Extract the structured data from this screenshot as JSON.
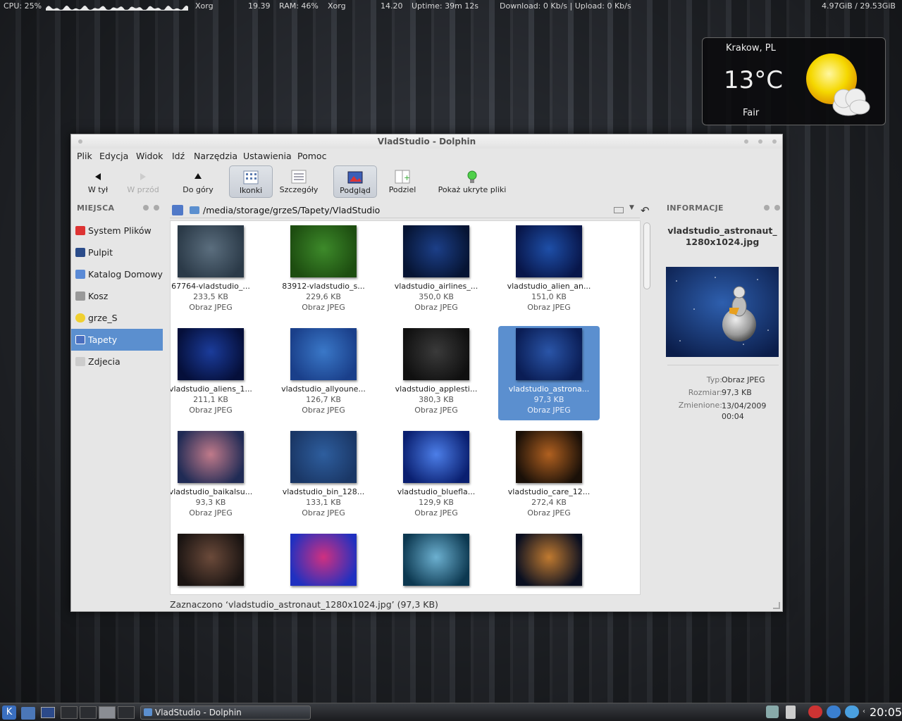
{
  "topbar": {
    "cpu_label": "CPU: 25%",
    "proc1": "Xorg",
    "val1": "19.39",
    "ram_label": "RAM: 46%",
    "proc2": "Xorg",
    "val2": "14.20",
    "uptime": "Uptime: 39m 12s",
    "network": "Download: 0 Kb/s | Upload: 0 Kb/s",
    "disk": "4.97GiB / 29.53GiB",
    "cpu_usage": 0.25
  },
  "weather": {
    "city": "Krakow, PL",
    "temp": "13°C",
    "condition": "Fair",
    "icon": "sun-cloud-icon"
  },
  "window": {
    "title": "VladStudio - Dolphin",
    "menu": [
      "Plik",
      "Edycja",
      "Widok",
      "Idź",
      "Narzędzia",
      "Ustawienia",
      "Pomoc"
    ],
    "toolbar": {
      "back": "W tył",
      "forward": "W przód",
      "up": "Do góry",
      "icons": "Ikonki",
      "details": "Szczegóły",
      "preview": "Podgląd",
      "split": "Podziel",
      "hidden": "Pokaż ukryte pliki"
    },
    "places": {
      "header": "MIEJSCA",
      "items": [
        "System Plików",
        "Pulpit",
        "Katalog Domowy",
        "Kosz",
        "grze_S",
        "Tapety",
        "Zdjecia"
      ],
      "selected": "Tapety"
    },
    "location": "/media/storage/grzeS/Tapety/VladStudio",
    "files": [
      {
        "name": "67764-vladstudio_...",
        "size": "233,5 KB",
        "type": "Obraz JPEG"
      },
      {
        "name": "83912-vladstudio_s...",
        "size": "229,6 KB",
        "type": "Obraz JPEG"
      },
      {
        "name": "vladstudio_airlines_...",
        "size": "350,0 KB",
        "type": "Obraz JPEG"
      },
      {
        "name": "vladstudio_alien_an...",
        "size": "151,0 KB",
        "type": "Obraz JPEG"
      },
      {
        "name": "vladstudio_aliens_1...",
        "size": "211,1 KB",
        "type": "Obraz JPEG"
      },
      {
        "name": "vladstudio_allyoune...",
        "size": "126,7 KB",
        "type": "Obraz JPEG"
      },
      {
        "name": "vladstudio_applesti...",
        "size": "380,3 KB",
        "type": "Obraz JPEG"
      },
      {
        "name": "vladstudio_astrona...",
        "size": "97,3 KB",
        "type": "Obraz JPEG"
      },
      {
        "name": "vladstudio_baikalsu...",
        "size": "93,3 KB",
        "type": "Obraz JPEG"
      },
      {
        "name": "vladstudio_bin_128...",
        "size": "133,1 KB",
        "type": "Obraz JPEG"
      },
      {
        "name": "vladstudio_bluefla...",
        "size": "129,9 KB",
        "type": "Obraz JPEG"
      },
      {
        "name": "vladstudio_care_12...",
        "size": "272,4 KB",
        "type": "Obraz JPEG"
      },
      {
        "name": "",
        "size": "",
        "type": ""
      },
      {
        "name": "",
        "size": "",
        "type": ""
      },
      {
        "name": "",
        "size": "",
        "type": ""
      },
      {
        "name": "",
        "size": "",
        "type": ""
      }
    ],
    "selected_file_index": 7,
    "info": {
      "header": "INFORMACJE",
      "filename": "vladstudio_astronaut_ 1280x1024.jpg",
      "type_label": "Typ:",
      "type_value": "Obraz JPEG",
      "size_label": "Rozmiar:",
      "size_value": "97,3 KB",
      "modified_label": "Zmienione:",
      "modified_value": "13/04/2009 00:04"
    },
    "status": "Zaznaczono ‘vladstudio_astronaut_1280x1024.jpg’ (97,3 KB)"
  },
  "taskbar": {
    "task_title": "VladStudio - Dolphin",
    "clock": "20:05"
  },
  "colors": {
    "selection": "#5b8fcf",
    "desktop": "#2a2d33"
  }
}
